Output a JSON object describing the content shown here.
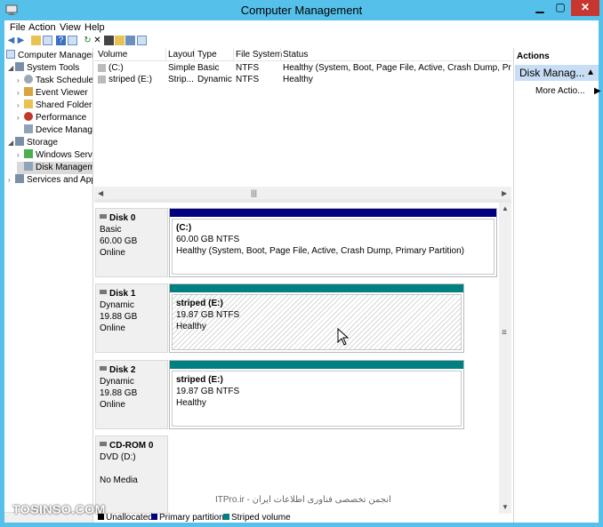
{
  "window": {
    "title": "Computer Management",
    "min": "▁",
    "max": "▢",
    "close": "✕"
  },
  "menu": [
    "File",
    "Action",
    "View",
    "Help"
  ],
  "tree": [
    {
      "label": "Computer Managem",
      "indent": 0,
      "expander": ""
    },
    {
      "label": "System Tools",
      "indent": 1,
      "expander": "◢"
    },
    {
      "label": "Task Scheduler",
      "indent": 2,
      "expander": "›"
    },
    {
      "label": "Event Viewer",
      "indent": 2,
      "expander": "›"
    },
    {
      "label": "Shared Folders",
      "indent": 2,
      "expander": "›"
    },
    {
      "label": "Performance",
      "indent": 2,
      "expander": "›"
    },
    {
      "label": "Device Manager",
      "indent": 2,
      "expander": ""
    },
    {
      "label": "Storage",
      "indent": 1,
      "expander": "◢"
    },
    {
      "label": "Windows Serve",
      "indent": 2,
      "expander": "›"
    },
    {
      "label": "Disk Manageme",
      "indent": 2,
      "expander": ""
    },
    {
      "label": "Services and Appl",
      "indent": 1,
      "expander": "›"
    }
  ],
  "volumes": {
    "headers": [
      "Volume",
      "Layout",
      "Type",
      "File System",
      "Status"
    ],
    "rows": [
      {
        "volume": "(C:)",
        "layout": "Simple",
        "type": "Basic",
        "fs": "NTFS",
        "status": "Healthy (System, Boot, Page File, Active, Crash Dump, Primary"
      },
      {
        "volume": "striped (E:)",
        "layout": "Strip...",
        "type": "Dynamic",
        "fs": "NTFS",
        "status": "Healthy"
      }
    ]
  },
  "disks": [
    {
      "name": "Disk 0",
      "type": "Basic",
      "size": "60.00 GB",
      "state": "Online",
      "part": {
        "title": "(C:)",
        "size": "60.00 GB NTFS",
        "status": "Healthy (System, Boot, Page File, Active, Crash Dump, Primary Partition)"
      }
    },
    {
      "name": "Disk 1",
      "type": "Dynamic",
      "size": "19.88 GB",
      "state": "Online",
      "part": {
        "title": "striped  (E:)",
        "size": "19.87 GB NTFS",
        "status": "Healthy"
      }
    },
    {
      "name": "Disk 2",
      "type": "Dynamic",
      "size": "19.88 GB",
      "state": "Online",
      "part": {
        "title": "striped  (E:)",
        "size": "19.87 GB NTFS",
        "status": "Healthy"
      }
    },
    {
      "name": "CD-ROM 0",
      "type": "DVD (D:)",
      "size": "",
      "state": "No Media"
    }
  ],
  "legend": [
    {
      "label": "Unallocated",
      "color": "#000000"
    },
    {
      "label": "Primary partition",
      "color": "#000080"
    },
    {
      "label": "Striped volume",
      "color": "#008080"
    }
  ],
  "actions": {
    "title": "Actions",
    "selected": "Disk Manag...",
    "more": "More Actio..."
  },
  "watermark": {
    "left": "TOSINSO.COM",
    "mid": "ITPro.ir - انجمن تخصصی فناوری اطلاعات ایران"
  },
  "colors": {
    "primary": "#000080",
    "striped": "#008080",
    "frame": "#55c1ea"
  }
}
